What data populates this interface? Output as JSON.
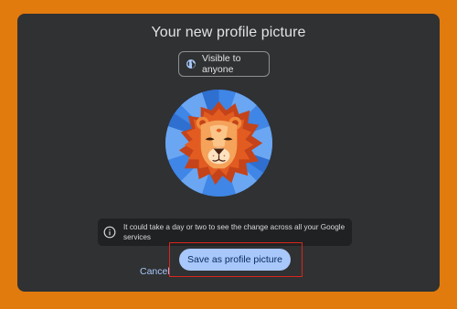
{
  "dialog": {
    "title": "Your new profile picture",
    "visibility_label": "Visible to anyone",
    "visibility_icon": "globe-icon",
    "avatar_description": "lion-avatar",
    "info_icon": "info-icon",
    "info_text": "It could take a day or two to see the change across all your Google services",
    "cancel_label": "Cancel",
    "save_label": "Save as profile picture"
  },
  "colors": {
    "background": "#e27b0d",
    "dialog": "#2f3133",
    "accent": "#a8c7fa",
    "highlight": "#d9261c"
  }
}
